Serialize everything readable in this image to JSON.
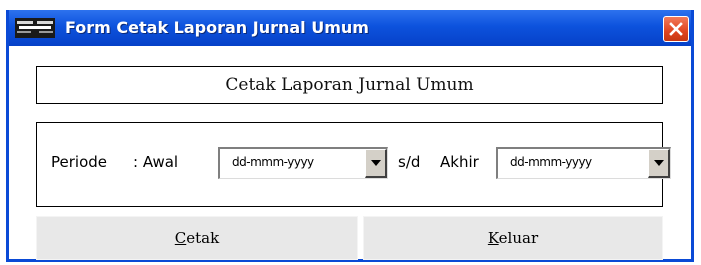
{
  "window": {
    "title": "Form Cetak Laporan Jurnal Umum",
    "icon": "app-icon",
    "close_icon": "close-icon"
  },
  "header": {
    "text": "Cetak Laporan Jurnal Umum"
  },
  "period": {
    "label": "Periode",
    "start_label": ": Awal",
    "start_value": "dd-mmm-yyyy",
    "separator": "s/d",
    "end_label": "Akhir",
    "end_value": "dd-mmm-yyyy",
    "dropdown_icon": "chevron-down-icon"
  },
  "buttons": {
    "print": {
      "mnemonic": "C",
      "rest": "etak"
    },
    "exit": {
      "mnemonic": "K",
      "rest": "eluar"
    }
  },
  "colors": {
    "titlebar": "#0d52dd",
    "close_button": "#e0441f",
    "button_face": "#e8e8e8"
  }
}
